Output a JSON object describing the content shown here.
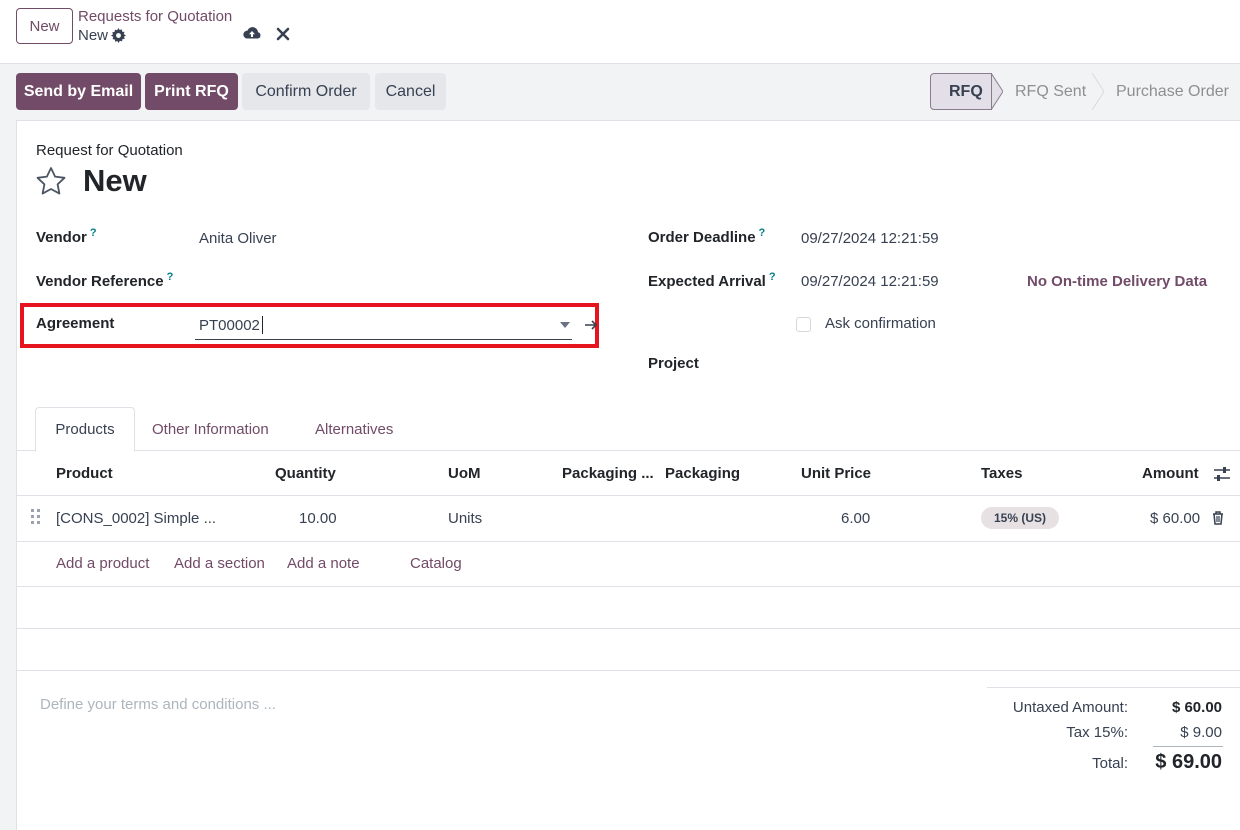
{
  "control_panel": {
    "new_button": "New",
    "breadcrumb_parent": "Requests for Quotation",
    "breadcrumb_current": "New"
  },
  "actions": {
    "send_by_email": "Send by Email",
    "print_rfq": "Print RFQ",
    "confirm_order": "Confirm Order",
    "cancel": "Cancel"
  },
  "status_stages": [
    "RFQ",
    "RFQ Sent",
    "Purchase Order"
  ],
  "form": {
    "subtitle": "Request for Quotation",
    "title": "New",
    "vendor_label": "Vendor",
    "vendor_value": "Anita Oliver",
    "vendor_reference_label": "Vendor Reference",
    "agreement_label": "Agreement",
    "agreement_value": "PT00002",
    "order_deadline_label": "Order Deadline",
    "order_deadline_value": "09/27/2024 12:21:59",
    "expected_arrival_label": "Expected Arrival",
    "expected_arrival_value": "09/27/2024 12:21:59",
    "on_time_delivery": "No On-time Delivery Data",
    "ask_confirmation_label": "Ask confirmation",
    "project_label": "Project",
    "help_marker": "?"
  },
  "tabs": [
    "Products",
    "Other Information",
    "Alternatives"
  ],
  "table": {
    "headers": [
      "Product",
      "Quantity",
      "UoM",
      "Packaging ...",
      "Packaging",
      "Unit Price",
      "Taxes",
      "Amount"
    ],
    "rows": [
      {
        "product": "[CONS_0002] Simple ...",
        "quantity": "10.00",
        "uom": "Units",
        "unit_price": "6.00",
        "taxes": "15% (US)",
        "amount": "$ 60.00"
      }
    ],
    "add_links": [
      "Add a product",
      "Add a section",
      "Add a note",
      "Catalog"
    ]
  },
  "terms_placeholder": "Define your terms and conditions ...",
  "totals": {
    "untaxed_label": "Untaxed Amount:",
    "untaxed_value": "$ 60.00",
    "tax_label": "Tax 15%:",
    "tax_value": "$ 9.00",
    "total_label": "Total:",
    "total_value": "$ 69.00"
  },
  "colors": {
    "brand": "#714b67",
    "highlight_box": "#e5141f"
  }
}
